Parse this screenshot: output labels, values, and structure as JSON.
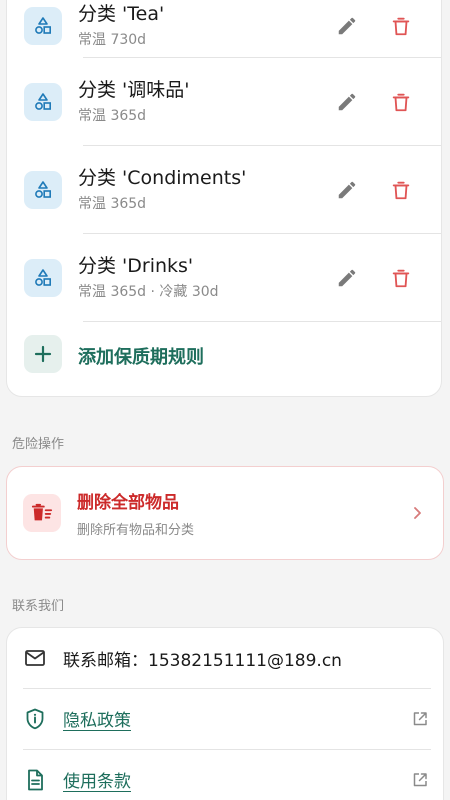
{
  "colors": {
    "accent": "#1e6e5c",
    "danger": "#cc2a2a",
    "category_icon": "#1f7ab8",
    "muted": "#8a8a8a"
  },
  "rules": {
    "items": [
      {
        "icon": "category-shapes-icon",
        "title": "分类 'Tea'",
        "sub": "常温 730d"
      },
      {
        "icon": "category-shapes-icon",
        "title": "分类 '调味品'",
        "sub": "常温 365d"
      },
      {
        "icon": "category-shapes-icon",
        "title": "分类 'Condiments'",
        "sub": "常温 365d"
      },
      {
        "icon": "category-shapes-icon",
        "title": "分类 'Drinks'",
        "sub": "常温 365d · 冷藏 30d"
      }
    ],
    "add_label": "添加保质期规则"
  },
  "danger": {
    "section_label": "危险操作",
    "title": "删除全部物品",
    "subtitle": "删除所有物品和分类"
  },
  "contact": {
    "section_label": "联系我们",
    "email_label": "联系邮箱：15382151111@189.cn",
    "privacy_label": "隐私政策",
    "terms_label": "使用条款"
  }
}
